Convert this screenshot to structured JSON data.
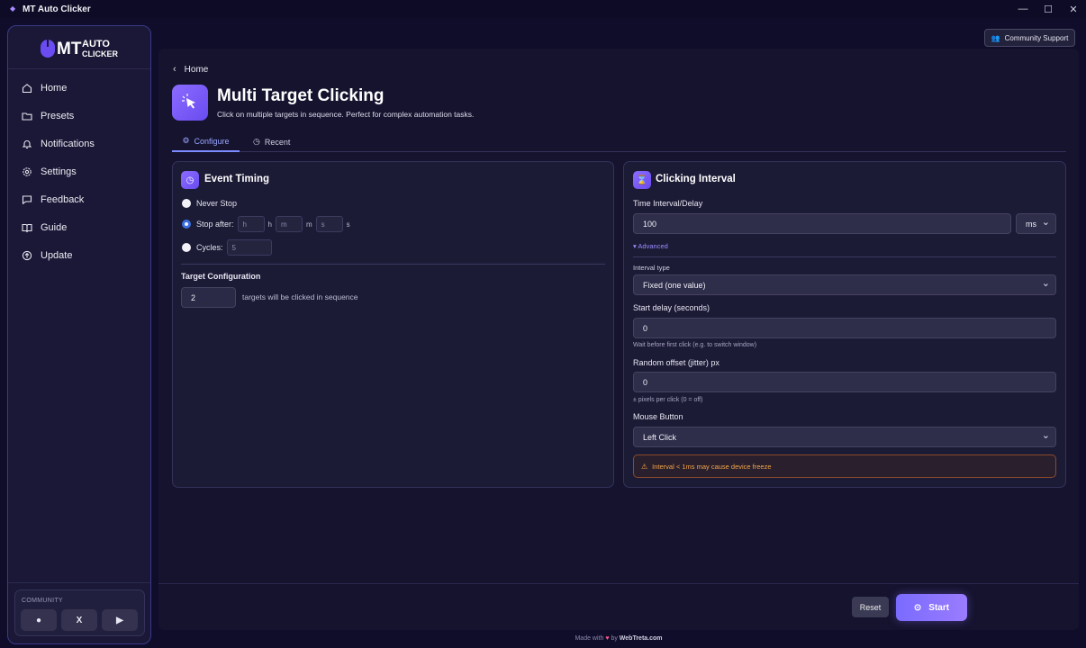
{
  "window": {
    "title": "MT Auto Clicker"
  },
  "logo": {
    "line1": "MT",
    "line2": "AUTO",
    "line3": "CLICKER"
  },
  "sidebar": {
    "items": [
      {
        "label": "Home",
        "icon": "home-icon"
      },
      {
        "label": "Presets",
        "icon": "folder-icon"
      },
      {
        "label": "Notifications",
        "icon": "bell-icon"
      },
      {
        "label": "Settings",
        "icon": "gear-icon"
      },
      {
        "label": "Feedback",
        "icon": "message-icon"
      },
      {
        "label": "Guide",
        "icon": "book-icon"
      },
      {
        "label": "Update",
        "icon": "update-icon"
      }
    ],
    "community": {
      "title": "COMMUNITY",
      "x_label": "X"
    }
  },
  "header": {
    "community_support": "Community Support"
  },
  "breadcrumb": {
    "back_label": "Home"
  },
  "page": {
    "title": "Multi Target Clicking",
    "subtitle": "Click on multiple targets in sequence. Perfect for complex automation tasks."
  },
  "tabs": [
    {
      "label": "Configure",
      "active": true
    },
    {
      "label": "Recent",
      "active": false
    }
  ],
  "event_timing": {
    "title": "Event Timing",
    "never_stop": "Never Stop",
    "stop_after": "Stop after:",
    "h_placeholder": "h",
    "h_unit": "h",
    "m_placeholder": "m",
    "m_unit": "m",
    "s_placeholder": "s",
    "s_unit": "s",
    "cycles": "Cycles:",
    "cycles_placeholder": "5",
    "selected": "stop_after",
    "target_config_title": "Target Configuration",
    "targets_value": "2",
    "targets_text": "targets will be clicked in sequence"
  },
  "clicking_interval": {
    "title": "Clicking Interval",
    "time_label": "Time Interval/Delay",
    "time_value": "100",
    "unit_value": "ms",
    "advanced_label": "▾ Advanced",
    "interval_type_label": "Interval type",
    "interval_type_value": "Fixed (one value)",
    "start_delay_label": "Start delay (seconds)",
    "start_delay_value": "0",
    "start_delay_hint": "Wait before first click (e.g. to switch window)",
    "jitter_label": "Random offset (jitter) px",
    "jitter_value": "0",
    "jitter_hint": "± pixels per click (0 = off)",
    "mouse_button_label": "Mouse Button",
    "mouse_button_value": "Left Click",
    "warning": "Interval < 1ms may cause device freeze"
  },
  "actions": {
    "reset": "Reset",
    "start": "Start"
  },
  "footer": {
    "made_with": "Made with",
    "by": "by",
    "brand": "WebTreta.com"
  },
  "colors": {
    "accent": "#7a6bff",
    "warning": "#f4a64a",
    "background": "#100d2b"
  }
}
